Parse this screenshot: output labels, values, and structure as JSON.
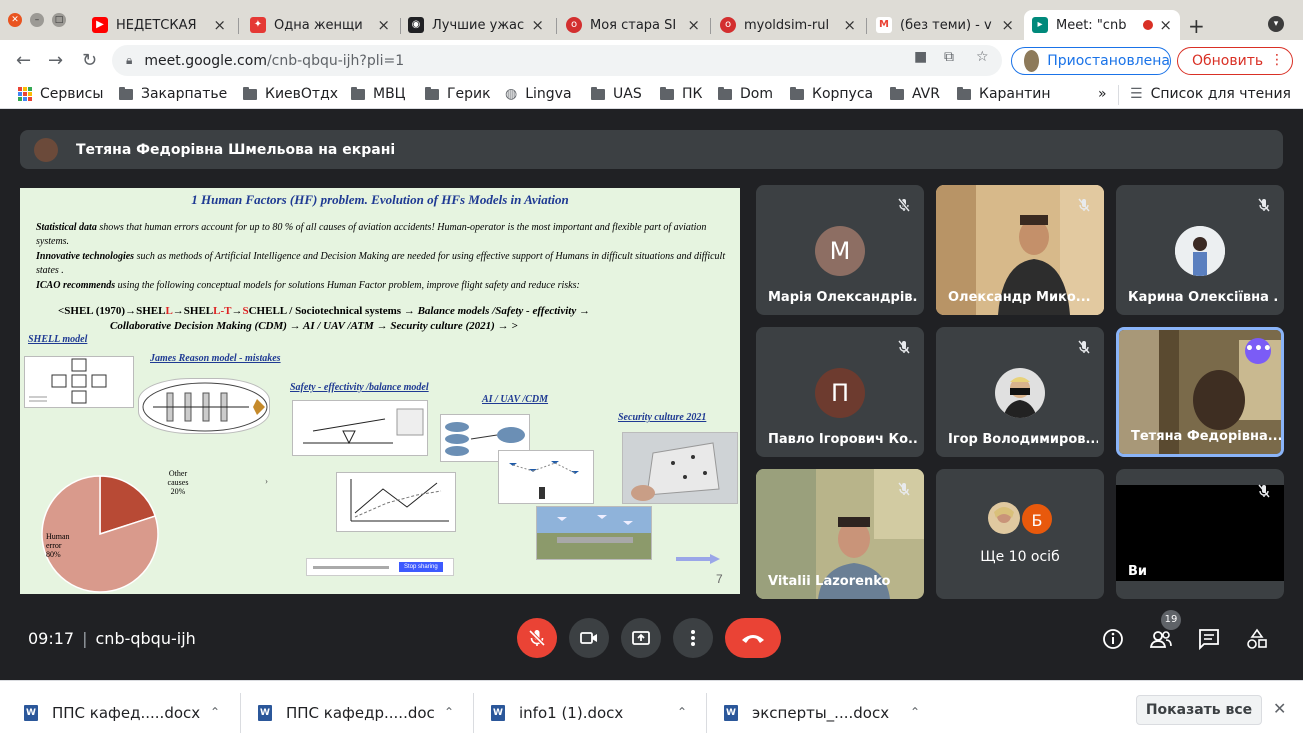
{
  "tabs": [
    {
      "title": "НЕДЕТСКАЯ",
      "color": "#ff0000",
      "glyph": "▶"
    },
    {
      "title": "Одна женщи",
      "color": "#e53935",
      "glyph": "✦"
    },
    {
      "title": "Лучшие ужас",
      "color": "#202124",
      "glyph": "◉"
    },
    {
      "title": "Моя стара SI",
      "color": "#d32f2f",
      "glyph": "⬮"
    },
    {
      "title": "myoldsim-rul",
      "color": "#d32f2f",
      "glyph": "⬮"
    },
    {
      "title": "(без теми) - v",
      "color": "#ea4335",
      "glyph": "M"
    },
    {
      "title": "Meet: \"cnb",
      "color": "#00897b",
      "glyph": "▸"
    }
  ],
  "toolbar": {
    "url_host": "meet.google.com",
    "url_path": "/cnb-qbqu-ijh?pli=1",
    "profile_label": "Приостановлена",
    "update_label": "Обновить"
  },
  "bookmarks": {
    "items": [
      "Сервисы",
      "Закарпатье",
      "КиевОтдх",
      "МВЦ",
      "Герик",
      "Lingva",
      "UAS",
      "ПК",
      "Dom",
      "Корпуса",
      "AVR",
      "Карантин"
    ],
    "overflow": "»",
    "reading_list": "Список для чтения"
  },
  "presenting": {
    "text": "Тетяна Федорівна Шмельова на екрані"
  },
  "slide": {
    "title": "1 Human Factors (HF) problem. Evolution of HFs Models in Aviation",
    "p1_bold": "Statistical data",
    "p1_rest": " shows that human errors account for up to 80 % of all causes of aviation accidents! Human-operator    is the most important and flexible part of aviation systems.",
    "p2_bold": "Innovative technologies",
    "p2_rest": " such as methods of Artificial Intelligence and Decision Making are needed for using effective support of Humans in difficult situations and difficult states .",
    "p3_bold": "ICAO recommends",
    "p3_rest": " using the following conceptual models for solutions Human Factor problem,  improve flight safety and reduce risks:",
    "chain_line1_a": "<SHEL (1970)→SHEL",
    "chain_line1_b": "L",
    "chain_line1_c": "→SHEL",
    "chain_line1_d": "L-T",
    "chain_line1_e": "→",
    "chain_line1_f": "S",
    "chain_line1_g": "CHELL / Sociotechnical systems → ",
    "chain_line1_h": "Balance models /Safety - effectivity  →",
    "chain_line2": "Collaborative Decision Making (CDM) → AI / UAV /ATM → Security culture (2021) → >",
    "labels": {
      "shell": "SHELL model",
      "reason": "James Reason model - mistakes",
      "safety": "Safety - effectivity /balance model",
      "ai": "AI / UAV /CDM",
      "security": "Security culture 2021"
    },
    "pie_other_label": "Other causes 20%",
    "pie_human_label": "Human error 80%",
    "page_number": "7",
    "share_button": "Stop sharing"
  },
  "chart_data": {
    "type": "pie",
    "categories": [
      "Human error",
      "Other causes"
    ],
    "values": [
      80,
      20
    ],
    "colors": [
      "#d99a8c",
      "#b84a35"
    ]
  },
  "participants": [
    {
      "name": "Марія Олександрів...",
      "initial": "М",
      "avatar_color": "#8d6e63",
      "muted": true,
      "type": "initial"
    },
    {
      "name": "Олександр Мико...",
      "muted": true,
      "type": "video"
    },
    {
      "name": "Карина Олексіївна ...",
      "muted": true,
      "type": "photo"
    },
    {
      "name": "Павло Ігорович Ко...",
      "initial": "П",
      "avatar_color": "#6d3b2f",
      "muted": true,
      "type": "initial"
    },
    {
      "name": "Ігор Володимиров...",
      "muted": true,
      "type": "photo"
    },
    {
      "name": "Тетяна Федорівна...",
      "muted": false,
      "type": "video",
      "more": "•••"
    },
    {
      "name": "Vitalii Lazorenko",
      "muted": true,
      "type": "video"
    },
    {
      "name": "Ще 10 осіб",
      "initial": "Б",
      "avatar_color": "#e8590c",
      "type": "more"
    },
    {
      "name": "Ви",
      "muted": true,
      "type": "self"
    }
  ],
  "meeting": {
    "time": "09:17",
    "code": "cnb-qbqu-ijh",
    "people_count": "19"
  },
  "downloads": {
    "files": [
      "ППС кафед.....docx",
      "ППС кафедр.....doc",
      "info1 (1).docx",
      "эксперты_....docx"
    ],
    "show_all": "Показать все"
  }
}
